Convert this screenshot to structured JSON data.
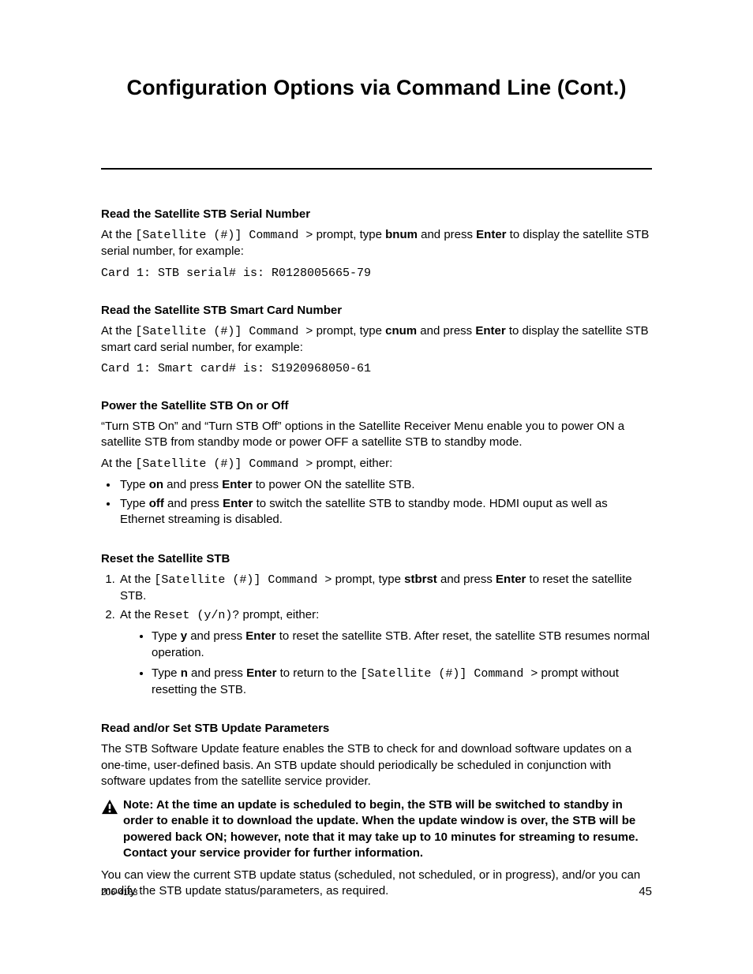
{
  "title": "Configuration Options via Command Line (Cont.)",
  "sec1": {
    "heading": "Read the Satellite STB Serial Number",
    "p1_a": "At the ",
    "p1_prompt": "[Satellite (#)] Command >",
    "p1_b": " prompt, type ",
    "p1_cmd": "bnum",
    "p1_c": " and press ",
    "p1_key": "Enter",
    "p1_d": " to display the satellite STB serial number, for example:",
    "code": "Card 1: STB serial# is: R0128005665-79"
  },
  "sec2": {
    "heading": "Read the Satellite STB Smart Card Number",
    "p1_a": "At the ",
    "p1_prompt": "[Satellite (#)] Command >",
    "p1_b": " prompt, type ",
    "p1_cmd": "cnum",
    "p1_c": " and press ",
    "p1_key": "Enter",
    "p1_d": " to display the satellite STB smart card serial number, for example:",
    "code": "Card 1: Smart card# is: S1920968050-61"
  },
  "sec3": {
    "heading": "Power the Satellite STB On or Off",
    "p1": "“Turn STB On” and “Turn STB Off” options in the Satellite Receiver Menu enable you to power ON a satellite STB from standby mode or power OFF a satellite STB to standby mode.",
    "p2_a": "At the ",
    "p2_prompt": "[Satellite (#)] Command >",
    "p2_b": " prompt, either:",
    "b1_a": "Type ",
    "b1_cmd": "on",
    "b1_b": " and press ",
    "b1_key": "Enter",
    "b1_c": " to power ON the satellite STB.",
    "b2_a": "Type ",
    "b2_cmd": "off",
    "b2_b": " and press ",
    "b2_key": "Enter",
    "b2_c": " to switch the satellite STB to standby mode. HDMI ouput as well as Ethernet streaming is disabled."
  },
  "sec4": {
    "heading": "Reset the Satellite STB",
    "s1_a": "At the ",
    "s1_prompt": "[Satellite (#)] Command >",
    "s1_b": " prompt, type ",
    "s1_cmd": "stbrst",
    "s1_c": " and press ",
    "s1_key": "Enter",
    "s1_d": " to reset the satellite STB.",
    "s2_a": "At the ",
    "s2_prompt": "Reset (y/n)?",
    "s2_b": " prompt, either:",
    "sb1_a": "Type ",
    "sb1_cmd": "y",
    "sb1_b": " and press ",
    "sb1_key": "Enter",
    "sb1_c": " to reset the satellite STB. After reset, the satellite STB resumes normal operation.",
    "sb2_a": "Type ",
    "sb2_cmd": "n",
    "sb2_b": " and press ",
    "sb2_key": "Enter",
    "sb2_c": " to return to the ",
    "sb2_prompt": "[Satellite (#)] Command >",
    "sb2_d": " prompt without resetting the STB."
  },
  "sec5": {
    "heading": "Read and/or Set STB Update Parameters",
    "p1": "The STB Software Update feature enables the STB to check for and download software updates on a one-time, user-defined basis. An STB update should periodically be scheduled in conjunction with software updates from the satellite service provider.",
    "note": "Note: At the time an update is scheduled to begin, the STB will be switched to standby in order to enable it to download the update. When the update window is over, the STB will be powered back ON; however, note that it may take up to 10 minutes for streaming to resume. Contact your service provider for further information.",
    "p2": "You can view the current STB update status (scheduled, not scheduled, or in progress), and/or you can modify the STB update status/parameters, as required."
  },
  "footer": {
    "doc_id": "206-4183",
    "page_no": "45"
  }
}
